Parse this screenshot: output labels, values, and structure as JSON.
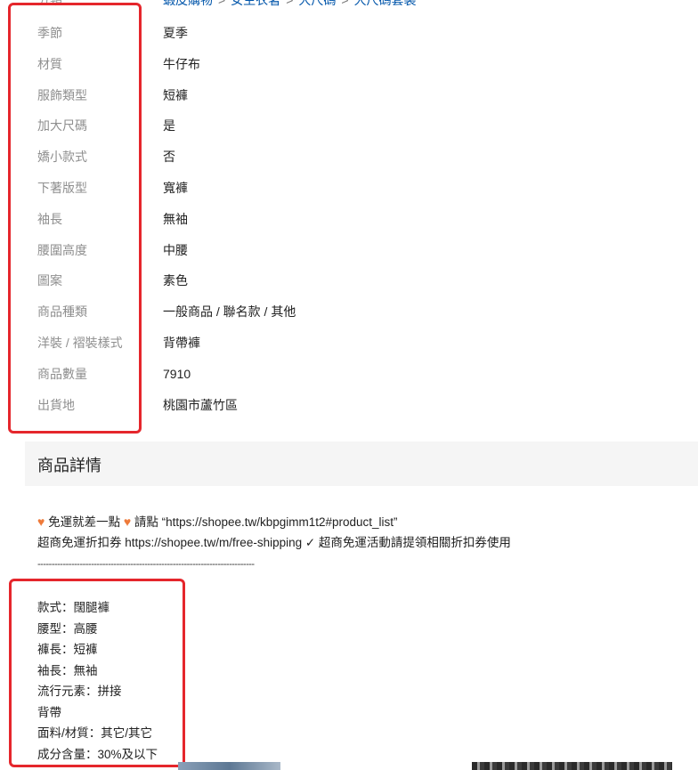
{
  "breadcrumb": {
    "label": "分類",
    "items": [
      "蝦皮購物",
      "女生衣著",
      "大尺碼",
      "大尺碼套裝"
    ],
    "separator": ">"
  },
  "specs": [
    {
      "key": "季節",
      "value": "夏季"
    },
    {
      "key": "材質",
      "value": "牛仔布"
    },
    {
      "key": "服飾類型",
      "value": "短褲"
    },
    {
      "key": "加大尺碼",
      "value": "是"
    },
    {
      "key": "嬌小款式",
      "value": "否"
    },
    {
      "key": "下著版型",
      "value": "寬褲"
    },
    {
      "key": "袖長",
      "value": "無袖"
    },
    {
      "key": "腰圍高度",
      "value": "中腰"
    },
    {
      "key": "圖案",
      "value": "素色"
    },
    {
      "key": "商品種類",
      "value": "一般商品 / 聯名款 / 其他"
    },
    {
      "key": "洋裝 / 褶裝樣式",
      "value": "背帶褲"
    },
    {
      "key": "商品數量",
      "value": "7910"
    },
    {
      "key": "出貨地",
      "value": "桃園市蘆竹區"
    }
  ],
  "detail": {
    "title": "商品詳情",
    "line1_text": "免運就差一點",
    "line1_tail": "請點 “https://shopee.tw/kbpgimm1t2#product_list”",
    "line2": "超商免運折扣券 https://shopee.tw/m/free-shipping ✓ 超商免運活動請提領相關折扣券使用",
    "divider": "-----------------------------------------------------------------------------",
    "attributes": [
      "款式：闊腿褲",
      "腰型：高腰",
      "褲長：短褲",
      "袖長：無袖",
      "流行元素：拼接",
      "背帶",
      "面料/材質：其它/其它",
      "成分含量：30%及以下"
    ]
  },
  "colors": {
    "highlight_box": "#e5262c",
    "heart": "#ee7a3a",
    "link": "#0055aa"
  }
}
